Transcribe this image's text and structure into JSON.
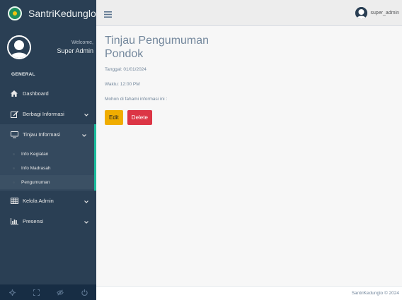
{
  "brand": {
    "name": "SantriKedunglo",
    "logo_icon": "school-logo-icon"
  },
  "profile": {
    "welcome": "Welcome,",
    "name": "Super Admin"
  },
  "sidebar": {
    "section_title": "GENERAL",
    "items": [
      {
        "label": "Dashboard",
        "icon": "home-icon"
      },
      {
        "label": "Berbagi Informasi",
        "icon": "edit-icon",
        "has_submenu": true
      },
      {
        "label": "Tinjau Informasi",
        "icon": "desktop-icon",
        "has_submenu": true,
        "expanded": true,
        "subitems": [
          {
            "label": "Info Kegiatan"
          },
          {
            "label": "Info Madrasah"
          },
          {
            "label": "Pengumuman",
            "active": true
          }
        ]
      },
      {
        "label": "Kelola Admin",
        "icon": "table-icon",
        "has_submenu": true
      },
      {
        "label": "Presensi",
        "icon": "bar-chart-icon",
        "has_submenu": true
      }
    ],
    "footer_icons": [
      "settings-icon",
      "fullscreen-icon",
      "eye-slash-icon",
      "power-icon"
    ]
  },
  "topnav": {
    "user": "super_admin"
  },
  "main": {
    "title": "Tinjau Pengumuman Pondok",
    "date": "Tanggal: 01/01/2024",
    "time": "Waktu: 12:00 PM",
    "message": "Mohon di fahami informasi ini :",
    "edit_label": "Edit",
    "delete_label": "Delete"
  },
  "footer": {
    "copyright": "SantriKedunglo © 2024"
  },
  "colors": {
    "sidebar": "#2a3f54",
    "accent": "#1abb9c",
    "edit_button": "#f0ad00",
    "delete_button": "#dc3545"
  }
}
